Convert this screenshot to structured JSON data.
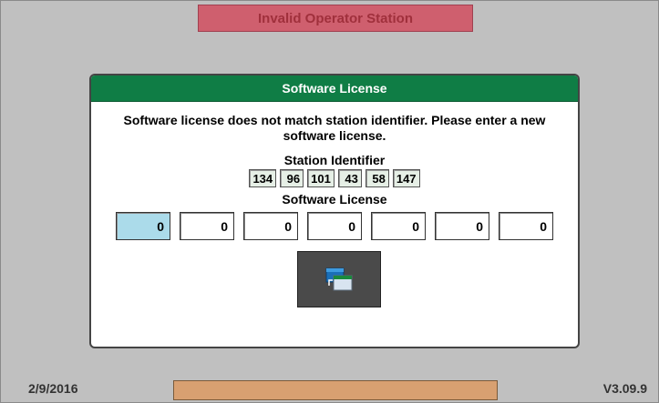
{
  "status_banner": "Invalid Operator Station",
  "dialog": {
    "title": "Software License",
    "message": "Software license does not match station identifier.  Please enter a new software license.",
    "station_label": "Station Identifier",
    "station_identifier": [
      "134",
      "96",
      "101",
      "43",
      "58",
      "147"
    ],
    "license_label": "Software License",
    "license_fields": [
      "0",
      "0",
      "0",
      "0",
      "0",
      "0",
      "0"
    ],
    "active_field_index": 0,
    "action_icon": "window-switch-icon"
  },
  "footer": {
    "date": "2/9/2016",
    "version": "V3.09.9"
  },
  "colors": {
    "background": "#c0c0c0",
    "banner": "#cf5f6e",
    "header": "#0f7d45",
    "active_field": "#abdbea",
    "footer_bar": "#d8a071"
  }
}
